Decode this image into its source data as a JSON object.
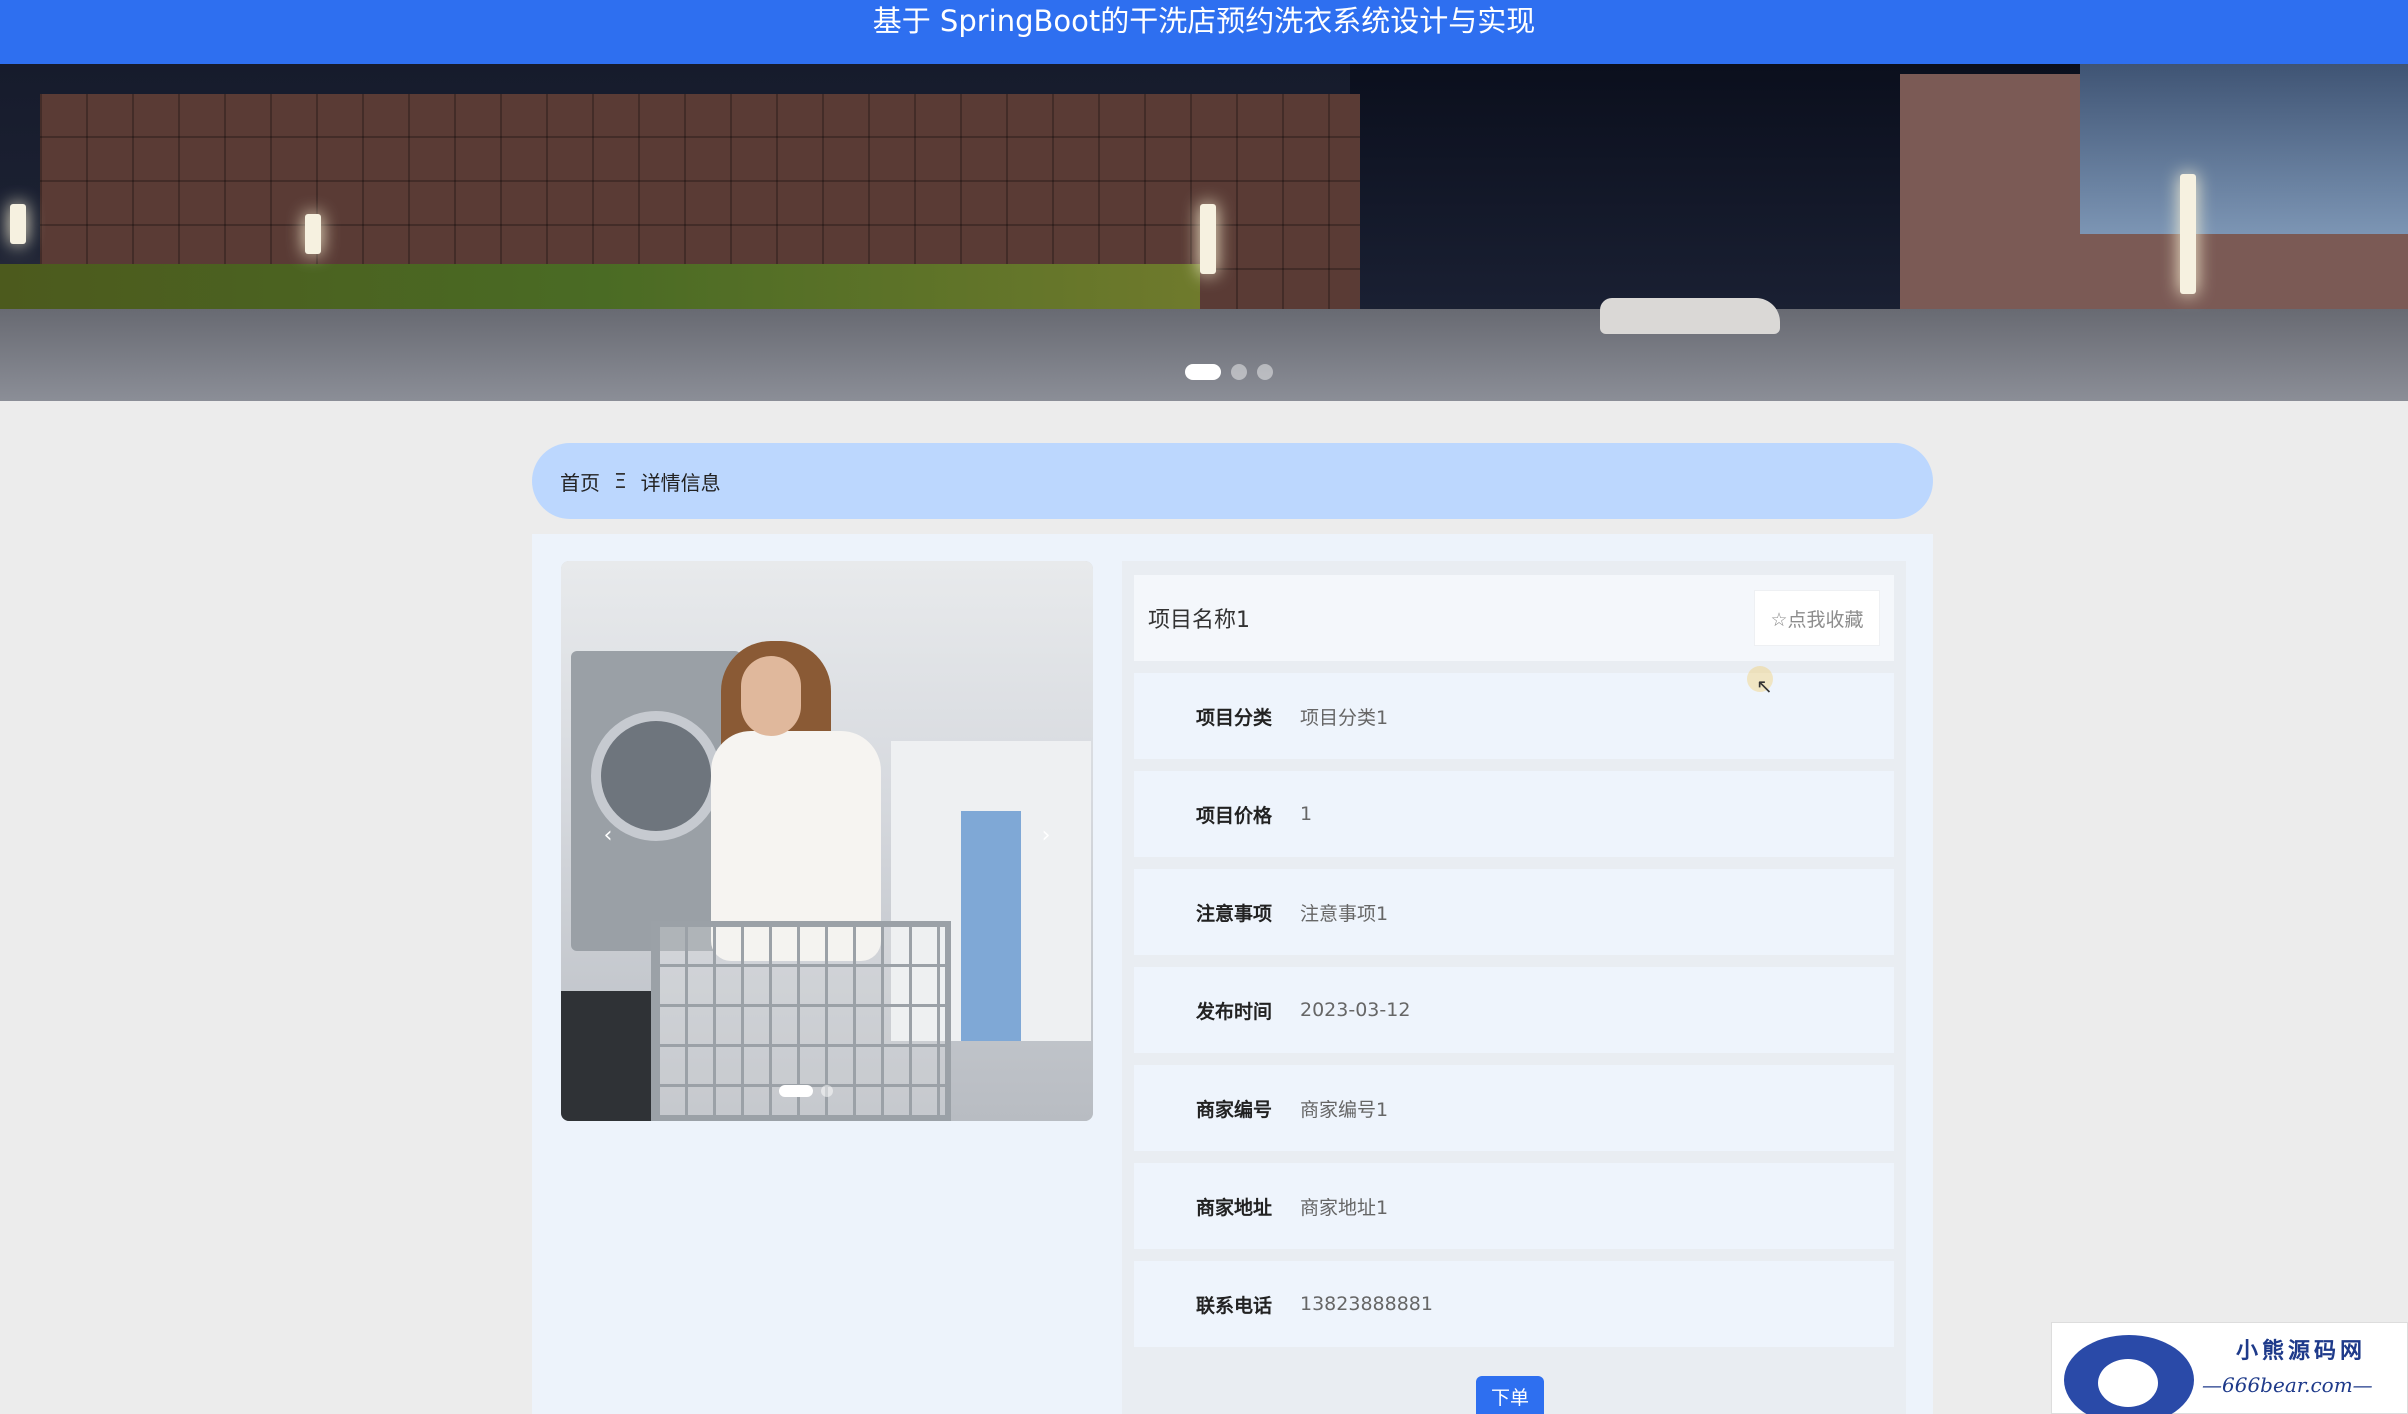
{
  "header": {
    "title": "基于 SpringBoot的干洗店预约洗衣系统设计与实现"
  },
  "banner": {
    "slides": 3,
    "active_slide": 1
  },
  "breadcrumb": {
    "home": "首页",
    "separator": "Ξ",
    "current": "详情信息"
  },
  "gallery": {
    "prev": "‹",
    "next": "›",
    "slides": 2,
    "active_slide": 1
  },
  "detail": {
    "name": "项目名称1",
    "favorite_label": "☆点我收藏",
    "fields": [
      {
        "label": "项目分类",
        "value": "项目分类1"
      },
      {
        "label": "项目价格",
        "value": "1"
      },
      {
        "label": "注意事项",
        "value": "注意事项1"
      },
      {
        "label": "发布时间",
        "value": "2023-03-12"
      },
      {
        "label": "商家编号",
        "value": "商家编号1"
      },
      {
        "label": "商家地址",
        "value": "商家地址1"
      },
      {
        "label": "联系电话",
        "value": "13823888881"
      }
    ],
    "order_label": "下单"
  },
  "watermark": {
    "name": "小熊源码网",
    "url": "—666bear.com—"
  },
  "colors": {
    "primary": "#2e6ff0",
    "breadcrumb_bg": "#bcd7fe",
    "panel_bg": "#edf3fb"
  }
}
